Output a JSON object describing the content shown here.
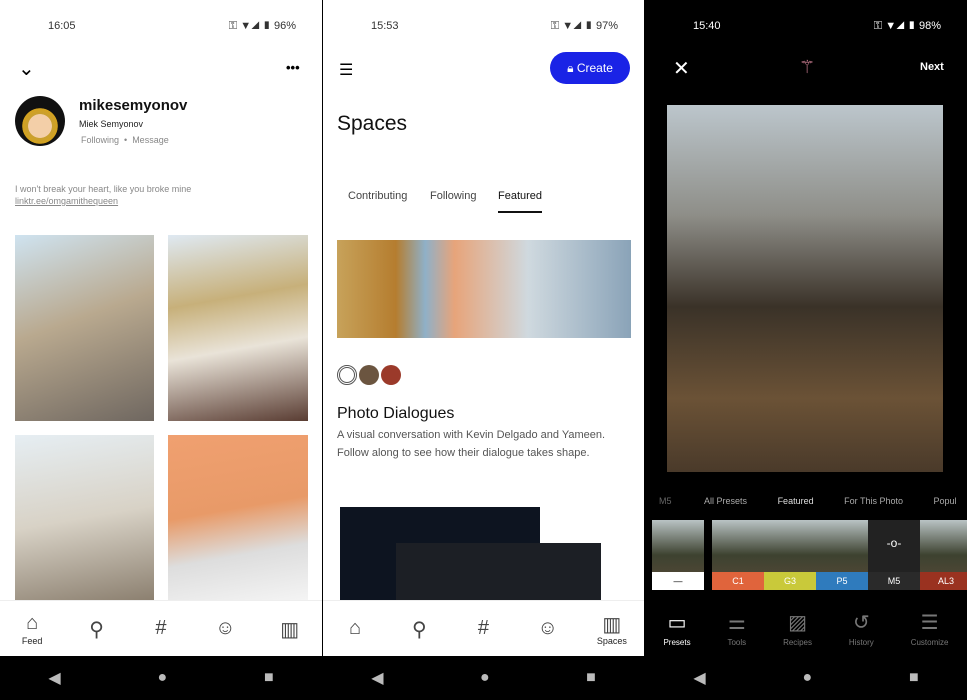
{
  "profile": {
    "time": "16:05",
    "battery": "96%",
    "username": "mikesemyonov",
    "name": "Miek Semyonov",
    "following": "Following",
    "message": "Message",
    "bio": "I won't break your heart, like you broke mine",
    "link": "linktr.ee/omgamithequeen",
    "more": "•••"
  },
  "spaces": {
    "time": "15:53",
    "battery": "97%",
    "create": "Create",
    "title": "Spaces",
    "tabs": [
      "Contributing",
      "Following",
      "Featured"
    ],
    "card_title": "Photo Dialogues",
    "card_desc": "A visual conversation with Kevin Delgado and Yameen. Follow along to see how their dialogue takes shape.",
    "spaces_label": "Spaces"
  },
  "bottom_nav": {
    "feed": "Feed"
  },
  "editor": {
    "time": "15:40",
    "battery": "98%",
    "next": "Next",
    "preset_tabs": [
      "M5",
      "All Presets",
      "Featured",
      "For This Photo",
      "Popul"
    ],
    "presets": [
      {
        "label": "—",
        "color": "#ffffff",
        "text": "#000000"
      },
      {
        "label": "C1",
        "color": "#e0643c"
      },
      {
        "label": "G3",
        "color": "#c9c93a"
      },
      {
        "label": "P5",
        "color": "#2f7bbd"
      },
      {
        "label": "M5",
        "color": "#2a2a2a"
      },
      {
        "label": "AL3",
        "color": "#9a3220"
      }
    ],
    "tools": [
      "Presets",
      "Tools",
      "Recipes",
      "History",
      "Customize"
    ]
  }
}
